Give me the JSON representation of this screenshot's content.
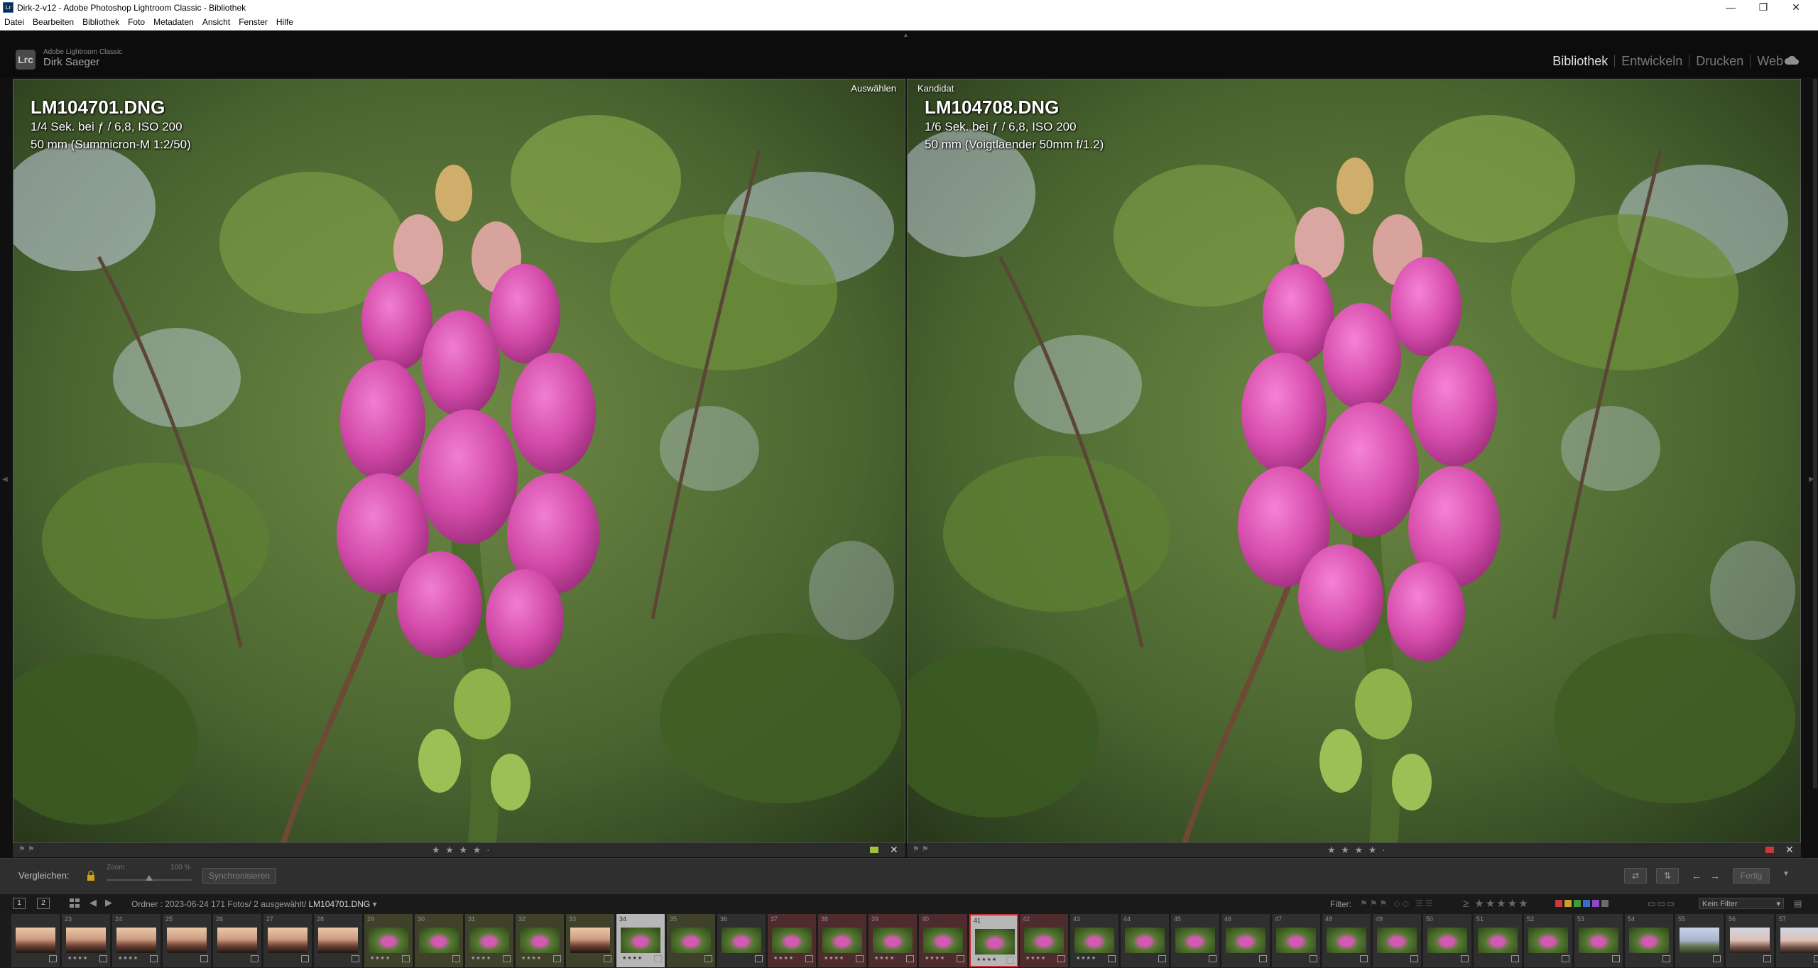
{
  "window": {
    "title": "Dirk-2-v12 - Adobe Photoshop Lightroom Classic - Bibliothek",
    "controls": [
      "—",
      "❐",
      "✕"
    ]
  },
  "menu": [
    "Datei",
    "Bearbeiten",
    "Bibliothek",
    "Foto",
    "Metadaten",
    "Ansicht",
    "Fenster",
    "Hilfe"
  ],
  "identity": {
    "logo": "Lrc",
    "app": "Adobe Lightroom Classic",
    "user": "Dirk Saeger"
  },
  "modules": [
    {
      "label": "Bibliothek",
      "active": true
    },
    {
      "label": "Entwickeln",
      "active": false
    },
    {
      "label": "Drucken",
      "active": false
    },
    {
      "label": "Web",
      "active": false
    }
  ],
  "compare": {
    "left": {
      "corner": "Auswählen",
      "filename": "LM104701.DNG",
      "exposure": "1/4 Sek. bei ƒ / 6,8, ISO 200",
      "lens": "50 mm (Summicron-M 1:2/50)",
      "rating": "★ ★ ★ ★ ·"
    },
    "right": {
      "corner": "Kandidat",
      "filename": "LM104708.DNG",
      "exposure": "1/6 Sek. bei ƒ / 6,8, ISO 200",
      "lens": "50 mm (Voigtlaender 50mm f/1.2)",
      "rating": "★ ★ ★ ★ ·"
    }
  },
  "toolbar": {
    "compare_label": "Vergleichen:",
    "zoom_label": "Zoom",
    "zoom_value": "100 %",
    "zoom_fraction": 0.5,
    "sync": "Synchronisieren",
    "done": "Fertig"
  },
  "filmstrip_header": {
    "screen1": "1",
    "screen2": "2",
    "path_prefix": "Ordner : 2023-06-24   171 Fotos/ 2 ausgewählt/",
    "current_file": "LM104701.DNG",
    "filter_label": "Filter:",
    "filter_value": "Kein Filter",
    "rating_op": "≥",
    "colors": [
      "#c63b3b",
      "#c9a22b",
      "#3f9a3f",
      "#3b6fc4",
      "#8a4ac4",
      "#6b6b6b"
    ]
  },
  "filmstrip": {
    "cells": [
      {
        "num": "",
        "thumb": "sunset",
        "stars": "",
        "state": ""
      },
      {
        "num": "23",
        "thumb": "sunset",
        "stars": "★★★★",
        "state": ""
      },
      {
        "num": "24",
        "thumb": "sunset",
        "stars": "★★★★",
        "state": ""
      },
      {
        "num": "25",
        "thumb": "sunset",
        "stars": "",
        "state": ""
      },
      {
        "num": "26",
        "thumb": "sunset",
        "stars": "",
        "state": ""
      },
      {
        "num": "27",
        "thumb": "sunset",
        "stars": "",
        "state": ""
      },
      {
        "num": "28",
        "thumb": "sunset",
        "stars": "",
        "state": ""
      },
      {
        "num": "29",
        "thumb": "flower",
        "stars": "★★★★",
        "state": "pick"
      },
      {
        "num": "30",
        "thumb": "flower",
        "stars": "",
        "state": "pick"
      },
      {
        "num": "31",
        "thumb": "flower",
        "stars": "★★★★",
        "state": "pick"
      },
      {
        "num": "32",
        "thumb": "flower",
        "stars": "★★★★",
        "state": "pick"
      },
      {
        "num": "33",
        "thumb": "sunset",
        "stars": "",
        "state": "pick"
      },
      {
        "num": "34",
        "thumb": "flower",
        "stars": "★★★★",
        "state": "sel"
      },
      {
        "num": "35",
        "thumb": "flower",
        "stars": "",
        "state": "pick"
      },
      {
        "num": "36",
        "thumb": "flower",
        "stars": "",
        "state": ""
      },
      {
        "num": "37",
        "thumb": "flower",
        "stars": "★★★★",
        "state": "red"
      },
      {
        "num": "38",
        "thumb": "flower",
        "stars": "★★★★",
        "state": "red"
      },
      {
        "num": "39",
        "thumb": "flower",
        "stars": "★★★★",
        "state": "red"
      },
      {
        "num": "40",
        "thumb": "flower",
        "stars": "★★★★",
        "state": "red"
      },
      {
        "num": "41",
        "thumb": "flower",
        "stars": "★★★★",
        "state": "rejsel"
      },
      {
        "num": "42",
        "thumb": "flower",
        "stars": "★★★★",
        "state": "red"
      },
      {
        "num": "43",
        "thumb": "flower",
        "stars": "★★★★",
        "state": ""
      },
      {
        "num": "44",
        "thumb": "flower",
        "stars": "",
        "state": ""
      },
      {
        "num": "45",
        "thumb": "flower",
        "stars": "",
        "state": ""
      },
      {
        "num": "46",
        "thumb": "flower",
        "stars": "",
        "state": ""
      },
      {
        "num": "47",
        "thumb": "flower",
        "stars": "",
        "state": ""
      },
      {
        "num": "48",
        "thumb": "flower",
        "stars": "",
        "state": ""
      },
      {
        "num": "49",
        "thumb": "flower",
        "stars": "",
        "state": ""
      },
      {
        "num": "50",
        "thumb": "flower",
        "stars": "",
        "state": ""
      },
      {
        "num": "51",
        "thumb": "flower",
        "stars": "",
        "state": ""
      },
      {
        "num": "52",
        "thumb": "flower",
        "stars": "",
        "state": ""
      },
      {
        "num": "53",
        "thumb": "flower",
        "stars": "",
        "state": ""
      },
      {
        "num": "54",
        "thumb": "flower",
        "stars": "",
        "state": ""
      },
      {
        "num": "55",
        "thumb": "field",
        "stars": "",
        "state": ""
      },
      {
        "num": "56",
        "thumb": "sunsetpale",
        "stars": "",
        "state": ""
      },
      {
        "num": "57",
        "thumb": "sunsetpale",
        "stars": "",
        "state": ""
      }
    ]
  }
}
